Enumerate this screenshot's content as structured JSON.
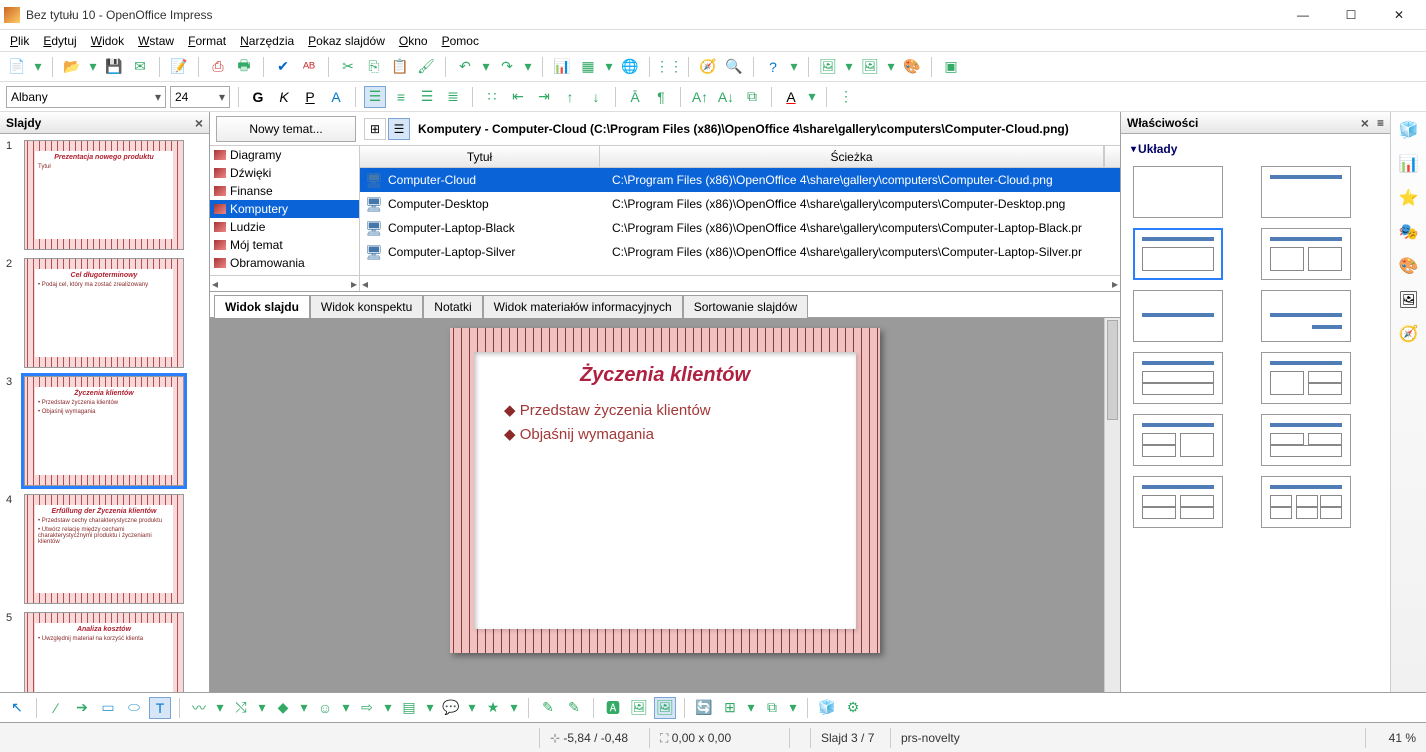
{
  "title": "Bez tytułu 10 - OpenOffice Impress",
  "menu": [
    "Plik",
    "Edytuj",
    "Widok",
    "Wstaw",
    "Format",
    "Narzędzia",
    "Pokaz slajdów",
    "Okno",
    "Pomoc"
  ],
  "font_name": "Albany",
  "font_size": "24",
  "slides_pane_title": "Slajdy",
  "thumbs": [
    {
      "n": "1",
      "title": "Prezentacja nowego produktu",
      "lines": [
        "Tytuł"
      ]
    },
    {
      "n": "2",
      "title": "Cel długoterminowy",
      "lines": [
        "• Podaj cel, który ma zostać zrealizowany"
      ]
    },
    {
      "n": "3",
      "title": "Życzenia klientów",
      "lines": [
        "• Przedstaw życzenia klientów",
        "• Objaśnij wymagania"
      ],
      "sel": true
    },
    {
      "n": "4",
      "title": "Erfüllung der Życzenia klientów",
      "lines": [
        "• Przedstaw cechy charakterystyczne produktu",
        "• Utwórz relację między cechami charakterystycznymi produktu i życzeniami klientów"
      ]
    },
    {
      "n": "5",
      "title": "Analiza kosztów",
      "lines": [
        "• Uwzględnij materiał na korzyść klienta"
      ]
    }
  ],
  "gallery": {
    "new_theme": "Nowy temat...",
    "title": "Komputery - Computer-Cloud (C:\\Program Files (x86)\\OpenOffice 4\\share\\gallery\\computers\\Computer-Cloud.png)",
    "themes": [
      "Diagramy",
      "Dźwięki",
      "Finanse",
      "Komputery",
      "Ludzie",
      "Mój temat",
      "Obramowania"
    ],
    "theme_sel": 3,
    "col_title": "Tytuł",
    "col_path": "Ścieżka",
    "rows": [
      {
        "t": "Computer-Cloud",
        "p": "C:\\Program Files (x86)\\OpenOffice 4\\share\\gallery\\computers\\Computer-Cloud.png",
        "sel": true
      },
      {
        "t": "Computer-Desktop",
        "p": "C:\\Program Files (x86)\\OpenOffice 4\\share\\gallery\\computers\\Computer-Desktop.png"
      },
      {
        "t": "Computer-Laptop-Black",
        "p": "C:\\Program Files (x86)\\OpenOffice 4\\share\\gallery\\computers\\Computer-Laptop-Black.pr"
      },
      {
        "t": "Computer-Laptop-Silver",
        "p": "C:\\Program Files (x86)\\OpenOffice 4\\share\\gallery\\computers\\Computer-Laptop-Silver.pr"
      }
    ]
  },
  "view_tabs": [
    "Widok slajdu",
    "Widok konspektu",
    "Notatki",
    "Widok materiałów informacyjnych",
    "Sortowanie slajdów"
  ],
  "slide": {
    "title": "Życzenia klientów",
    "bullets": [
      "Przedstaw życzenia klientów",
      "Objaśnij wymagania"
    ]
  },
  "properties_title": "Właściwości",
  "layouts_label": "Układy",
  "status": {
    "coords": "-5,84 / -0,48",
    "size": "0,00 x 0,00",
    "slide": "Slajd 3 / 7",
    "template": "prs-novelty",
    "zoom": "41 %"
  }
}
